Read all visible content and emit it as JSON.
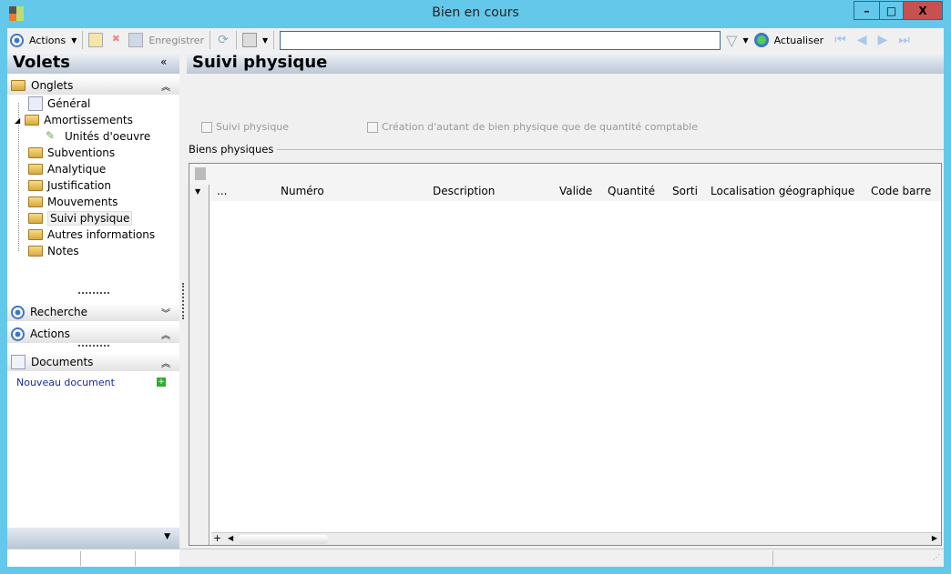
{
  "window": {
    "title": "Bien en cours",
    "minimize": "–",
    "maximize": "□",
    "close": "X"
  },
  "toolbar": {
    "actions": "Actions",
    "save": "Enregistrer",
    "refresh": "Actualiser",
    "search_value": ""
  },
  "left": {
    "title": "Volets",
    "collapse": "«",
    "tabs_header": "Onglets",
    "tree": [
      {
        "label": "Général"
      },
      {
        "label": "Amortissements"
      },
      {
        "label": "Unités d'oeuvre"
      },
      {
        "label": "Subventions"
      },
      {
        "label": "Analytique"
      },
      {
        "label": "Justification"
      },
      {
        "label": "Mouvements"
      },
      {
        "label": "Suivi physique"
      },
      {
        "label": "Autres informations"
      },
      {
        "label": "Notes"
      }
    ],
    "search_header": "Recherche",
    "actions_header": "Actions",
    "documents_header": "Documents",
    "new_document": "Nouveau document"
  },
  "main": {
    "title": "Suivi physique",
    "cb1": "Suivi physique",
    "cb2": "Création d'autant de bien physique que de quantité comptable",
    "group": "Biens physiques",
    "columns": [
      "...",
      "Numéro",
      "Description",
      "Valide",
      "Quantité",
      "Sorti",
      "Localisation géographique",
      "Code barre"
    ],
    "add": "+"
  }
}
